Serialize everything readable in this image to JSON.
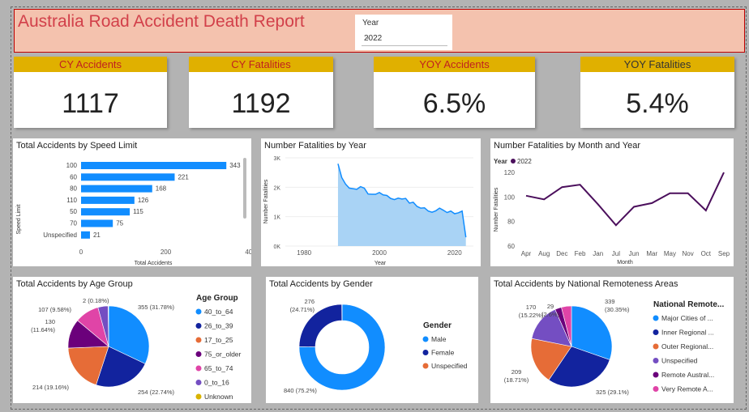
{
  "header": {
    "title": "Australia Road Accident Death Report",
    "year_label": "Year",
    "year_value": "2022"
  },
  "kpis": [
    {
      "label": "CY Accidents",
      "value": "1117"
    },
    {
      "label": "CY Fatalities",
      "value": "1192"
    },
    {
      "label": "YOY Accidents",
      "value": "6.5%"
    },
    {
      "label": "YOY Fatalities",
      "value": "5.4%"
    }
  ],
  "colors": {
    "blue": "#118dff",
    "navy": "#12239e",
    "orange": "#e66c37",
    "purple": "#6b007b",
    "pink": "#e044a7",
    "violet": "#744ec2",
    "gold": "#d9b300",
    "line": "#4b0f5c"
  },
  "chart_data": [
    {
      "type": "bar",
      "title": "Total Accidents by Speed Limit",
      "xlabel": "Total Accidents",
      "ylabel": "Speed Limit",
      "categories": [
        "100",
        "60",
        "80",
        "110",
        "50",
        "70",
        "Unspecified"
      ],
      "values": [
        343,
        221,
        168,
        126,
        115,
        75,
        21
      ],
      "xticks": [
        "0",
        "200",
        "400"
      ],
      "xlim": [
        0,
        400
      ]
    },
    {
      "type": "area",
      "title": "Number Fatalities by Year",
      "xlabel": "Year",
      "ylabel": "Number Fatalities",
      "xticks": [
        "1980",
        "2000",
        "2020"
      ],
      "yticks": [
        "0K",
        "1K",
        "2K",
        "3K"
      ],
      "xlim": [
        1975,
        2025
      ],
      "ylim": [
        0,
        3000
      ],
      "x": [
        1989,
        1990,
        1991,
        1992,
        1993,
        1994,
        1995,
        1996,
        1997,
        1998,
        1999,
        2000,
        2001,
        2002,
        2003,
        2004,
        2005,
        2006,
        2007,
        2008,
        2009,
        2010,
        2011,
        2012,
        2013,
        2014,
        2015,
        2016,
        2017,
        2018,
        2019,
        2020,
        2021,
        2022,
        2023
      ],
      "y": [
        2800,
        2330,
        2110,
        1970,
        1950,
        1930,
        2020,
        1970,
        1770,
        1760,
        1760,
        1820,
        1740,
        1720,
        1620,
        1580,
        1630,
        1600,
        1620,
        1460,
        1490,
        1350,
        1290,
        1300,
        1190,
        1150,
        1200,
        1290,
        1220,
        1140,
        1190,
        1100,
        1130,
        1190,
        300
      ]
    },
    {
      "type": "line",
      "title": "Number Fatalities by Month and Year",
      "xlabel": "Month",
      "ylabel": "Number Fatalities",
      "legend_title": "Year",
      "series_name": "2022",
      "categories": [
        "Apr",
        "Aug",
        "Dec",
        "Feb",
        "Jan",
        "Jul",
        "Jun",
        "Mar",
        "May",
        "Nov",
        "Oct",
        "Sep"
      ],
      "values": [
        101,
        98,
        108,
        110,
        94,
        77,
        92,
        95,
        103,
        103,
        89,
        120
      ],
      "yticks": [
        "60",
        "80",
        "100",
        "120"
      ],
      "ylim": [
        60,
        120
      ]
    },
    {
      "type": "pie",
      "title": "Total Accidents by Age Group",
      "legend_title": "Age Group",
      "categories": [
        "40_to_64",
        "26_to_39",
        "17_to_25",
        "75_or_older",
        "65_to_74",
        "0_to_16",
        "Unknown"
      ],
      "values": [
        355,
        254,
        214,
        130,
        107,
        45,
        2
      ],
      "labels": [
        "355 (31.78%)",
        "254 (22.74%)",
        "214 (19.16%)",
        "130 (11.64%)",
        "107 (9.58%)",
        "",
        "2 (0.18%)"
      ]
    },
    {
      "type": "pie",
      "title": "Total Accidents by Gender",
      "legend_title": "Gender",
      "categories": [
        "Male",
        "Female",
        "Unspecified"
      ],
      "values": [
        840,
        276,
        1
      ],
      "labels": [
        "840 (75.2%)",
        "276 (24.71%)",
        ""
      ]
    },
    {
      "type": "pie",
      "title": "Total Accidents by National Remoteness Areas",
      "legend_title": "National Remote...",
      "categories": [
        "Major Cities of ...",
        "Inner Regional ...",
        "Outer Regional...",
        "Unspecified",
        "Remote Austral...",
        "Very Remote A..."
      ],
      "values": [
        339,
        325,
        209,
        170,
        29,
        45
      ],
      "labels": [
        "339 (30.35%)",
        "325 (29.1%)",
        "209 (18.71%)",
        "170 (15.22%)",
        "29 (2.6%)",
        ""
      ]
    }
  ]
}
